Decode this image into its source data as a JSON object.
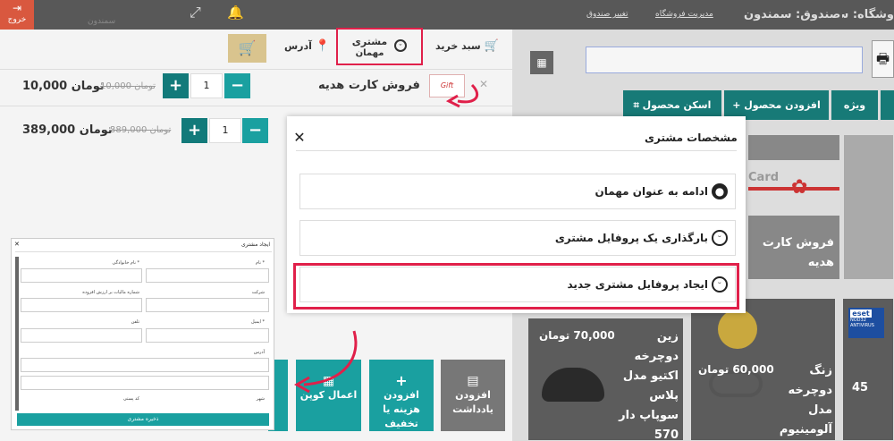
{
  "topbar": {
    "exit_label": "خروج",
    "store_text": "وشگاه: سمندون",
    "register_text": "صندوق: سمندون",
    "store_manage_link": "مدیریت فروشگاه",
    "change_register_link": "تغییر صندوق",
    "faded_text": "سمندون"
  },
  "cart_header": {
    "cart_label": "سبد خرید",
    "customer_label": "مشتری",
    "customer_value": "مهمان",
    "address_label": "آدرس"
  },
  "cart_items": [
    {
      "name": "فروش کارت هدیه",
      "qty": "1",
      "old_price": "10,000 تومان",
      "price": "10,000 تومان",
      "thumb_text": "Gift"
    },
    {
      "name": "",
      "qty": "1",
      "old_price": "389,000 تومان",
      "price": "389,000 تومان"
    }
  ],
  "tabs": [
    {
      "label": "اسکن محصول"
    },
    {
      "label": "افزودن محصول"
    },
    {
      "label": "ویژه"
    }
  ],
  "products": [
    {
      "title": "فروش کارت هدیه",
      "thumb_text": "Card"
    },
    {
      "title": "زنگ دوچرخه مدل آلومینیوم",
      "price": "60,000 تومان"
    },
    {
      "title": "زین دوچرخه اکتیو مدل پلاس سوپاپ دار 570",
      "price": "70,000 تومان"
    },
    {
      "price": "45",
      "brand": "eset",
      "brand_sub": "NOD32 ANTIVIRUS"
    }
  ],
  "actions": [
    {
      "label": "افزودن یادداشت"
    },
    {
      "label": "افزودن هزینه یا تخفیف"
    },
    {
      "label": "اعمال کوپن"
    }
  ],
  "modal": {
    "title": "مشخصات مشتری",
    "options": [
      {
        "label": "ادامه به عنوان مهمان"
      },
      {
        "label": "بارگذاری یک پروفایل مشتری"
      },
      {
        "label": "ایجاد پروفایل مشتری جدید"
      }
    ]
  },
  "form": {
    "title": "ایجاد مشتری",
    "first_name": "نام *",
    "last_name": "نام خانوادگی *",
    "company": "شرکت",
    "vat": "شماره مالیات بر ارزش افزوده",
    "email": "ایمیل *",
    "phone": "تلفن",
    "address": "آدرس",
    "city": "شهر",
    "postcode": "کد پستی",
    "save": "ذخیره مشتری"
  },
  "colors": {
    "accent": "#1aa0a0",
    "accent_dark": "#177a77",
    "highlight": "#e0204a",
    "topbar": "#585858",
    "exit": "#d9583f"
  }
}
